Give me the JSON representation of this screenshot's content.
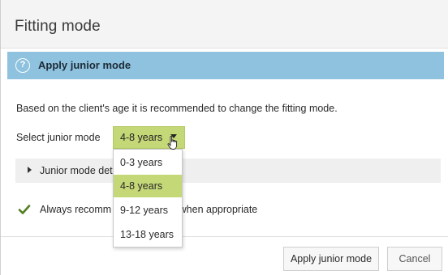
{
  "dialog": {
    "title": "Fitting mode"
  },
  "banner": {
    "icon": "?",
    "text": "Apply junior mode",
    "color": "#8ec2df"
  },
  "content": {
    "description": "Based on the client's age it is recommended to change the fitting mode.",
    "select_label": "Select junior mode",
    "selected_value": "4-8 years",
    "section_label": "Junior mode det",
    "checkbox_label_part1": "Always recomm",
    "checkbox_label_part2": "e when appropriate",
    "checkbox_checked": true
  },
  "dropdown": {
    "options": [
      "0-3 years",
      "4-8 years",
      "9-12 years",
      "13-18 years"
    ],
    "selected_index": 1,
    "highlight_color": "#c4d877"
  },
  "footer": {
    "apply_label": "Apply junior mode",
    "cancel_label": "Cancel"
  }
}
